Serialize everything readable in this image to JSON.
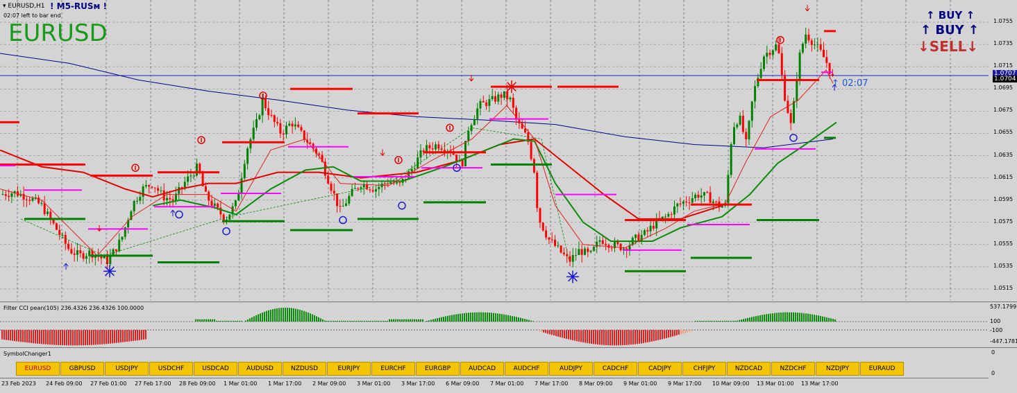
{
  "header": {
    "symbol_tf": "EURUSD,H1",
    "brand": "! M5-RUSм !",
    "timer_note": "02:07 left to bar end",
    "big_symbol": "EURUSD"
  },
  "signals": {
    "buy_small": "↑ BUY ↑",
    "buy_big": "↑ BUY ↑",
    "sell": "↓SELL↓",
    "countdown": "↑ 02:07"
  },
  "price_axis": {
    "ticks": [
      "1.0755",
      "1.0735",
      "1.0715",
      "1.0695",
      "1.0675",
      "1.0655",
      "1.0635",
      "1.0615",
      "1.0595",
      "1.0575",
      "1.0555",
      "1.0535",
      "1.0515"
    ],
    "current_marker": "1.0707",
    "current_bid": "1.0704"
  },
  "cci_panel": {
    "title": "Filter CCI pean(105)  236.4326 236.4326 100.0000",
    "ticks": [
      "537.1799",
      "100",
      "-100",
      "-447.1781"
    ]
  },
  "symbol_panel": {
    "title": "SymbolChanger1",
    "ticks": [
      "0",
      "0"
    ],
    "buttons": [
      "EURUSD",
      "GBPUSD",
      "USDJPY",
      "USDCHF",
      "USDCAD",
      "AUDUSD",
      "NZDUSD",
      "EURJPY",
      "EURCHF",
      "EURGBP",
      "AUDCAD",
      "AUDCHF",
      "AUDJPY",
      "CADCHF",
      "CADJPY",
      "CHFJPY",
      "NZDCAD",
      "NZDCHF",
      "NZDJPY",
      "EURAUD"
    ],
    "active": "EURUSD"
  },
  "time_axis": [
    "23 Feb 2023",
    "24 Feb 09:00",
    "27 Feb 01:00",
    "27 Feb 17:00",
    "28 Feb 09:00",
    "1 Mar 01:00",
    "1 Mar 17:00",
    "2 Mar 09:00",
    "3 Mar 01:00",
    "3 Mar 17:00",
    "6 Mar 09:00",
    "7 Mar 01:00",
    "7 Mar 17:00",
    "8 Mar 09:00",
    "9 Mar 01:00",
    "9 Mar 17:00",
    "10 Mar 09:00",
    "13 Mar 01:00",
    "13 Mar 17:00"
  ],
  "colors": {
    "background": "#d4d4d4",
    "bull": "#008000",
    "bear": "#ff0000",
    "resistance": "#ff0000",
    "support": "#008000",
    "pivot": "#ff00ff",
    "sma": "#00008b",
    "signal_buy": "#0000cc",
    "brand_text": "#000080",
    "big_symbol": "#1a9a1a",
    "button": "#f5c400"
  },
  "chart_data": {
    "type": "candlestick",
    "symbol": "EURUSD",
    "timeframe": "H1",
    "ylim": [
      1.0505,
      1.0775
    ],
    "grid": true,
    "last_price": 1.0704,
    "close_path": [
      [
        0,
        1.06
      ],
      [
        20,
        1.0602
      ],
      [
        40,
        1.0598
      ],
      [
        60,
        1.059
      ],
      [
        80,
        1.057
      ],
      [
        100,
        1.055
      ],
      [
        115,
        1.0545
      ],
      [
        130,
        1.0548
      ],
      [
        155,
        1.054
      ],
      [
        175,
        1.056
      ],
      [
        190,
        1.059
      ],
      [
        205,
        1.0605
      ],
      [
        220,
        1.061
      ],
      [
        235,
        1.0598
      ],
      [
        250,
        1.0595
      ],
      [
        265,
        1.061
      ],
      [
        285,
        1.0625
      ],
      [
        295,
        1.06
      ],
      [
        310,
        1.0588
      ],
      [
        325,
        1.0578
      ],
      [
        340,
        1.0592
      ],
      [
        355,
        1.064
      ],
      [
        370,
        1.0665
      ],
      [
        378,
        1.0685
      ],
      [
        390,
        1.067
      ],
      [
        405,
        1.0655
      ],
      [
        420,
        1.0665
      ],
      [
        440,
        1.065
      ],
      [
        460,
        1.0635
      ],
      [
        475,
        1.061
      ],
      [
        490,
        1.0585
      ],
      [
        505,
        1.06
      ],
      [
        520,
        1.061
      ],
      [
        540,
        1.0605
      ],
      [
        560,
        1.0612
      ],
      [
        575,
        1.0608
      ],
      [
        590,
        1.062
      ],
      [
        610,
        1.064
      ],
      [
        630,
        1.0645
      ],
      [
        650,
        1.064
      ],
      [
        665,
        1.0625
      ],
      [
        675,
        1.066
      ],
      [
        690,
        1.068
      ],
      [
        710,
        1.0685
      ],
      [
        725,
        1.069
      ],
      [
        735,
        1.0685
      ],
      [
        745,
        1.0665
      ],
      [
        760,
        1.065
      ],
      [
        770,
        1.062
      ],
      [
        775,
        1.058
      ],
      [
        790,
        1.056
      ],
      [
        805,
        1.055
      ],
      [
        820,
        1.054
      ],
      [
        835,
        1.055
      ],
      [
        850,
        1.0545
      ],
      [
        865,
        1.056
      ],
      [
        880,
        1.0555
      ],
      [
        900,
        1.0552
      ],
      [
        915,
        1.056
      ],
      [
        930,
        1.0565
      ],
      [
        945,
        1.0575
      ],
      [
        960,
        1.058
      ],
      [
        975,
        1.059
      ],
      [
        990,
        1.0595
      ],
      [
        1005,
        1.06
      ],
      [
        1020,
        1.0598
      ],
      [
        1035,
        1.059
      ],
      [
        1045,
        1.059
      ],
      [
        1055,
        1.066
      ],
      [
        1065,
        1.067
      ],
      [
        1075,
        1.0645
      ],
      [
        1085,
        1.069
      ],
      [
        1100,
        1.0725
      ],
      [
        1110,
        1.073
      ],
      [
        1120,
        1.0735
      ],
      [
        1130,
        1.069
      ],
      [
        1140,
        1.066
      ],
      [
        1150,
        1.072
      ],
      [
        1160,
        1.0745
      ],
      [
        1170,
        1.0738
      ],
      [
        1180,
        1.073
      ],
      [
        1190,
        1.072
      ],
      [
        1200,
        1.0704
      ]
    ],
    "ma_fast": [
      [
        0,
        1.0605
      ],
      [
        60,
        1.0595
      ],
      [
        100,
        1.057
      ],
      [
        140,
        1.0545
      ],
      [
        190,
        1.058
      ],
      [
        240,
        1.06
      ],
      [
        300,
        1.06
      ],
      [
        340,
        1.0585
      ],
      [
        390,
        1.064
      ],
      [
        440,
        1.065
      ],
      [
        490,
        1.061
      ],
      [
        560,
        1.0608
      ],
      [
        620,
        1.063
      ],
      [
        680,
        1.065
      ],
      [
        730,
        1.068
      ],
      [
        770,
        1.065
      ],
      [
        800,
        1.059
      ],
      [
        840,
        1.0555
      ],
      [
        900,
        1.0552
      ],
      [
        960,
        1.057
      ],
      [
        1000,
        1.0585
      ],
      [
        1045,
        1.0592
      ],
      [
        1075,
        1.063
      ],
      [
        1110,
        1.067
      ],
      [
        1150,
        1.0685
      ],
      [
        1190,
        1.0712
      ],
      [
        1200,
        1.07
      ]
    ],
    "ma_slow_green": [
      [
        220,
        1.059
      ],
      [
        260,
        1.0595
      ],
      [
        310,
        1.0588
      ],
      [
        340,
        1.0582
      ],
      [
        390,
        1.0605
      ],
      [
        440,
        1.0622
      ],
      [
        480,
        1.0625
      ],
      [
        520,
        1.0612
      ],
      [
        580,
        1.0612
      ],
      [
        640,
        1.0625
      ],
      [
        700,
        1.064
      ],
      [
        740,
        1.065
      ],
      [
        770,
        1.0648
      ],
      [
        800,
        1.061
      ],
      [
        840,
        1.0575
      ],
      [
        880,
        1.0558
      ],
      [
        940,
        1.0558
      ],
      [
        980,
        1.057
      ],
      [
        1040,
        1.058
      ],
      [
        1080,
        1.06
      ],
      [
        1120,
        1.0628
      ],
      [
        1160,
        1.0645
      ],
      [
        1205,
        1.0665
      ]
    ],
    "ma_red": [
      [
        0,
        1.064
      ],
      [
        60,
        1.0625
      ],
      [
        120,
        1.062
      ],
      [
        180,
        1.0605
      ],
      [
        220,
        1.0598
      ],
      [
        260,
        1.0605
      ],
      [
        300,
        1.061
      ],
      [
        340,
        1.061
      ],
      [
        400,
        1.062
      ],
      [
        460,
        1.062
      ],
      [
        520,
        1.0615
      ],
      [
        600,
        1.062
      ],
      [
        660,
        1.063
      ],
      [
        720,
        1.0645
      ],
      [
        770,
        1.065
      ],
      [
        820,
        1.0625
      ],
      [
        870,
        1.06
      ],
      [
        920,
        1.0578
      ],
      [
        980,
        1.0578
      ],
      [
        1040,
        1.059
      ]
    ],
    "sma_long": [
      [
        0,
        1.0727
      ],
      [
        100,
        1.0718
      ],
      [
        200,
        1.0703
      ],
      [
        300,
        1.0693
      ],
      [
        400,
        1.0685
      ],
      [
        500,
        1.0676
      ],
      [
        600,
        1.067
      ],
      [
        700,
        1.0667
      ],
      [
        800,
        1.0663
      ],
      [
        900,
        1.0652
      ],
      [
        1000,
        1.0645
      ],
      [
        1100,
        1.0642
      ],
      [
        1200,
        1.065
      ]
    ],
    "resistance_levels": [
      [
        0,
        28,
        1.0665
      ],
      [
        0,
        123,
        1.0627
      ],
      [
        130,
        220,
        1.0617
      ],
      [
        227,
        316,
        1.062
      ],
      [
        320,
        410,
        1.0647
      ],
      [
        418,
        508,
        1.0695
      ],
      [
        515,
        603,
        1.0673
      ],
      [
        610,
        700,
        1.0638
      ],
      [
        707,
        795,
        1.0697
      ],
      [
        803,
        891,
        1.0697
      ],
      [
        900,
        988,
        1.0577
      ],
      [
        995,
        1083,
        1.0591
      ],
      [
        1090,
        1180,
        1.0703
      ],
      [
        1187,
        1204,
        1.0747
      ]
    ],
    "support_levels": [
      [
        35,
        123,
        1.0578
      ],
      [
        130,
        220,
        1.0545
      ],
      [
        227,
        316,
        1.0539
      ],
      [
        320,
        410,
        1.0576
      ],
      [
        418,
        508,
        1.0568
      ],
      [
        515,
        603,
        1.0578
      ],
      [
        610,
        700,
        1.0593
      ],
      [
        707,
        795,
        1.0627
      ],
      [
        900,
        988,
        1.0531
      ],
      [
        995,
        1083,
        1.0543
      ],
      [
        1090,
        1180,
        1.0577
      ],
      [
        1187,
        1204,
        1.0651
      ]
    ],
    "pivot_levels": [
      [
        0,
        22,
        1.0626
      ],
      [
        35,
        118,
        1.0604
      ],
      [
        127,
        213,
        1.0569
      ],
      [
        222,
        310,
        1.0589
      ],
      [
        318,
        405,
        1.0601
      ],
      [
        415,
        502,
        1.0643
      ],
      [
        510,
        598,
        1.0616
      ],
      [
        607,
        695,
        1.0624
      ],
      [
        705,
        790,
        1.0668
      ],
      [
        800,
        888,
        1.06
      ],
      [
        897,
        982,
        1.055
      ],
      [
        990,
        1080,
        1.0573
      ],
      [
        1087,
        1175,
        1.0641
      ],
      [
        1183,
        1200,
        1.071
      ]
    ],
    "cci_histogram": "below -100 early (Feb 23–27), positive bursts around 1 Mar 17:00, 6 Mar, 13 Mar; deep negative after 7 Mar 17:00"
  }
}
